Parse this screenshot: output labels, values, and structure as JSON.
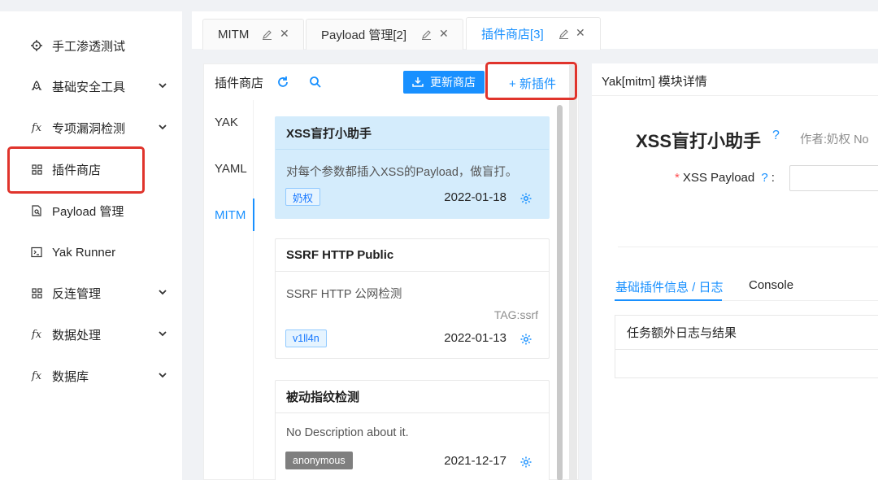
{
  "sidebar": {
    "items": [
      {
        "label": "手工渗透测试",
        "icon": "crosshair-icon",
        "expandable": false
      },
      {
        "label": "基础安全工具",
        "icon": "rocket-icon",
        "expandable": true
      },
      {
        "label": "专项漏洞检测",
        "icon": "function-icon",
        "expandable": true
      },
      {
        "label": "插件商店",
        "icon": "appstore-icon",
        "expandable": false
      },
      {
        "label": "Payload 管理",
        "icon": "file-search-icon",
        "expandable": false
      },
      {
        "label": "Yak Runner",
        "icon": "terminal-icon",
        "expandable": false
      },
      {
        "label": "反连管理",
        "icon": "appstore-icon",
        "expandable": true
      },
      {
        "label": "数据处理",
        "icon": "function-icon",
        "expandable": true
      },
      {
        "label": "数据库",
        "icon": "function-icon",
        "expandable": true
      }
    ]
  },
  "tabs": [
    {
      "label": "MITM",
      "active": false
    },
    {
      "label": "Payload 管理[2]",
      "active": false
    },
    {
      "label": "插件商店[3]",
      "active": true
    }
  ],
  "store": {
    "title": "插件商店",
    "update_button": "更新商店",
    "new_plugin_button": "+ 新插件",
    "type_tabs": [
      "YAK",
      "YAML",
      "MITM"
    ],
    "active_type": "MITM",
    "cards": [
      {
        "title": "XSS盲打小助手",
        "desc": "对每个参数都插入XSS的Payload，做盲打。",
        "tag_line": "",
        "author": "奶权",
        "date": "2022-01-18",
        "selected": true
      },
      {
        "title": "SSRF HTTP Public",
        "desc": "SSRF HTTP 公网检测",
        "tag_line": "TAG:ssrf",
        "author": "v1ll4n",
        "date": "2022-01-13",
        "selected": false
      },
      {
        "title": "被动指纹检测",
        "desc": "No Description about it.",
        "tag_line": "",
        "author": "anonymous",
        "date": "2021-12-17",
        "selected": false
      }
    ]
  },
  "detail": {
    "header": "Yak[mitm] 模块详情",
    "plugin_name": "XSS盲打小助手",
    "author_line": "作者:奶权",
    "author_overflow": "No",
    "param_label": "XSS Payload",
    "param_suffix": ":",
    "param_value": "",
    "tabs": [
      "基础插件信息 / 日志",
      "Console"
    ],
    "log_title": "任务额外日志与结果"
  },
  "colors": {
    "accent": "#1890ff",
    "highlight": "#e0342c",
    "selected_card": "#d4ecfc"
  }
}
